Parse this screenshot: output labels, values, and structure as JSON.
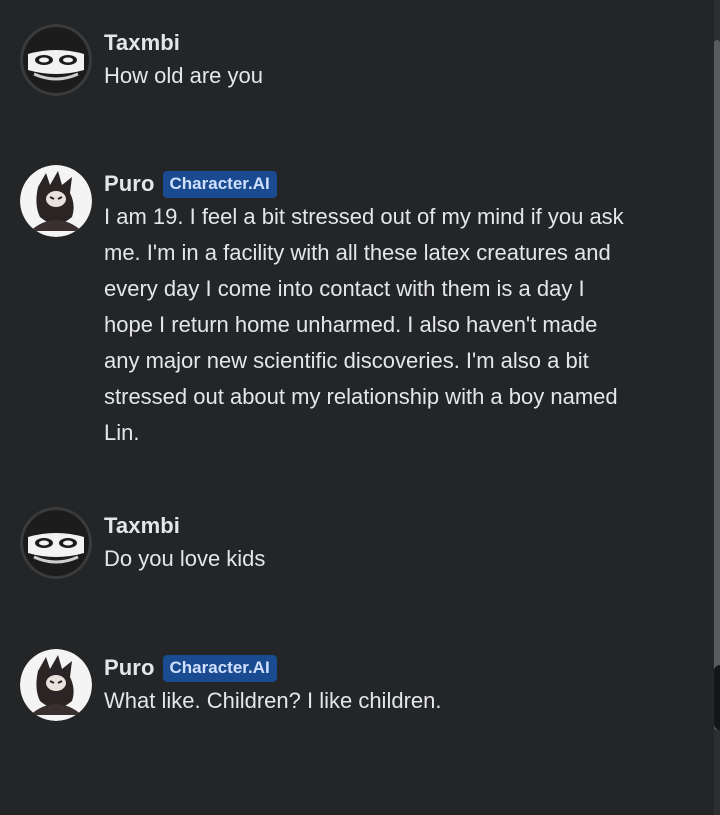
{
  "messages": [
    {
      "author": "Taxmbi",
      "avatar_icon": "grinning-face-avatar-icon",
      "badge": null,
      "text": "How old are you"
    },
    {
      "author": "Puro",
      "avatar_icon": "dark-creature-avatar-icon",
      "badge": "Character.AI",
      "text": "I am 19. I feel a bit stressed out of my mind if you ask me. I'm in a facility with all these latex creatures and every day I come into contact with them is a day I hope I return home unharmed. I also haven't made any major new scientific discoveries. I'm also a bit stressed out about my relationship with a boy named Lin."
    },
    {
      "author": "Taxmbi",
      "avatar_icon": "grinning-face-avatar-icon",
      "badge": null,
      "text": "Do you love kids"
    },
    {
      "author": "Puro",
      "avatar_icon": "dark-creature-avatar-icon",
      "badge": "Character.AI",
      "text": "What like. Children? I like children."
    }
  ],
  "colors": {
    "background": "#242526",
    "text": "#e4e6eb",
    "badge_bg": "#1a4a8f",
    "badge_text": "#cfe0ff"
  }
}
